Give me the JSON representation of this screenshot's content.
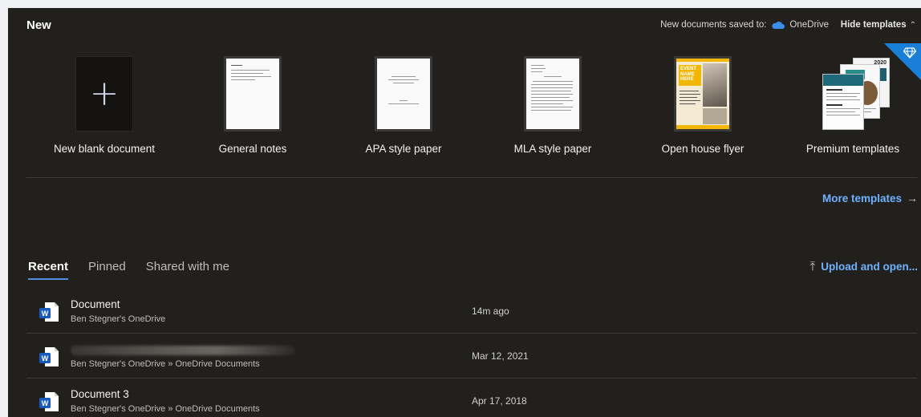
{
  "header": {
    "title": "New",
    "saved_to_label": "New documents saved to:",
    "saved_to_location": "OneDrive",
    "hide_templates": "Hide templates"
  },
  "templates": [
    {
      "label": "New blank document",
      "icon": "plus-icon"
    },
    {
      "label": "General notes"
    },
    {
      "label": "APA style paper"
    },
    {
      "label": "MLA style paper"
    },
    {
      "label": "Open house flyer"
    },
    {
      "label": "Premium templates",
      "icon": "premium-diamond-icon"
    }
  ],
  "flyer_text": "EVENT NAME HERE",
  "premium_year": "2020",
  "more_templates": "More templates",
  "tabs": [
    {
      "label": "Recent",
      "active": true
    },
    {
      "label": "Pinned",
      "active": false
    },
    {
      "label": "Shared with me",
      "active": false
    }
  ],
  "upload_open": "Upload and open...",
  "files": [
    {
      "name": "Document",
      "path": "Ben Stegner's OneDrive",
      "date": "14m ago",
      "name_redacted": false
    },
    {
      "name": "",
      "path": "Ben Stegner's OneDrive » OneDrive Documents",
      "date": "Mar 12, 2021",
      "name_redacted": true
    },
    {
      "name": "Document 3",
      "path": "Ben Stegner's OneDrive » OneDrive Documents",
      "date": "Apr 17, 2018",
      "name_redacted": false
    }
  ],
  "colors": {
    "panel_bg": "#22201d",
    "accent_link": "#6fb1ff",
    "tab_underline": "#4f8fe0",
    "premium_badge": "#1a7fd6",
    "word_blue": "#185abd"
  }
}
